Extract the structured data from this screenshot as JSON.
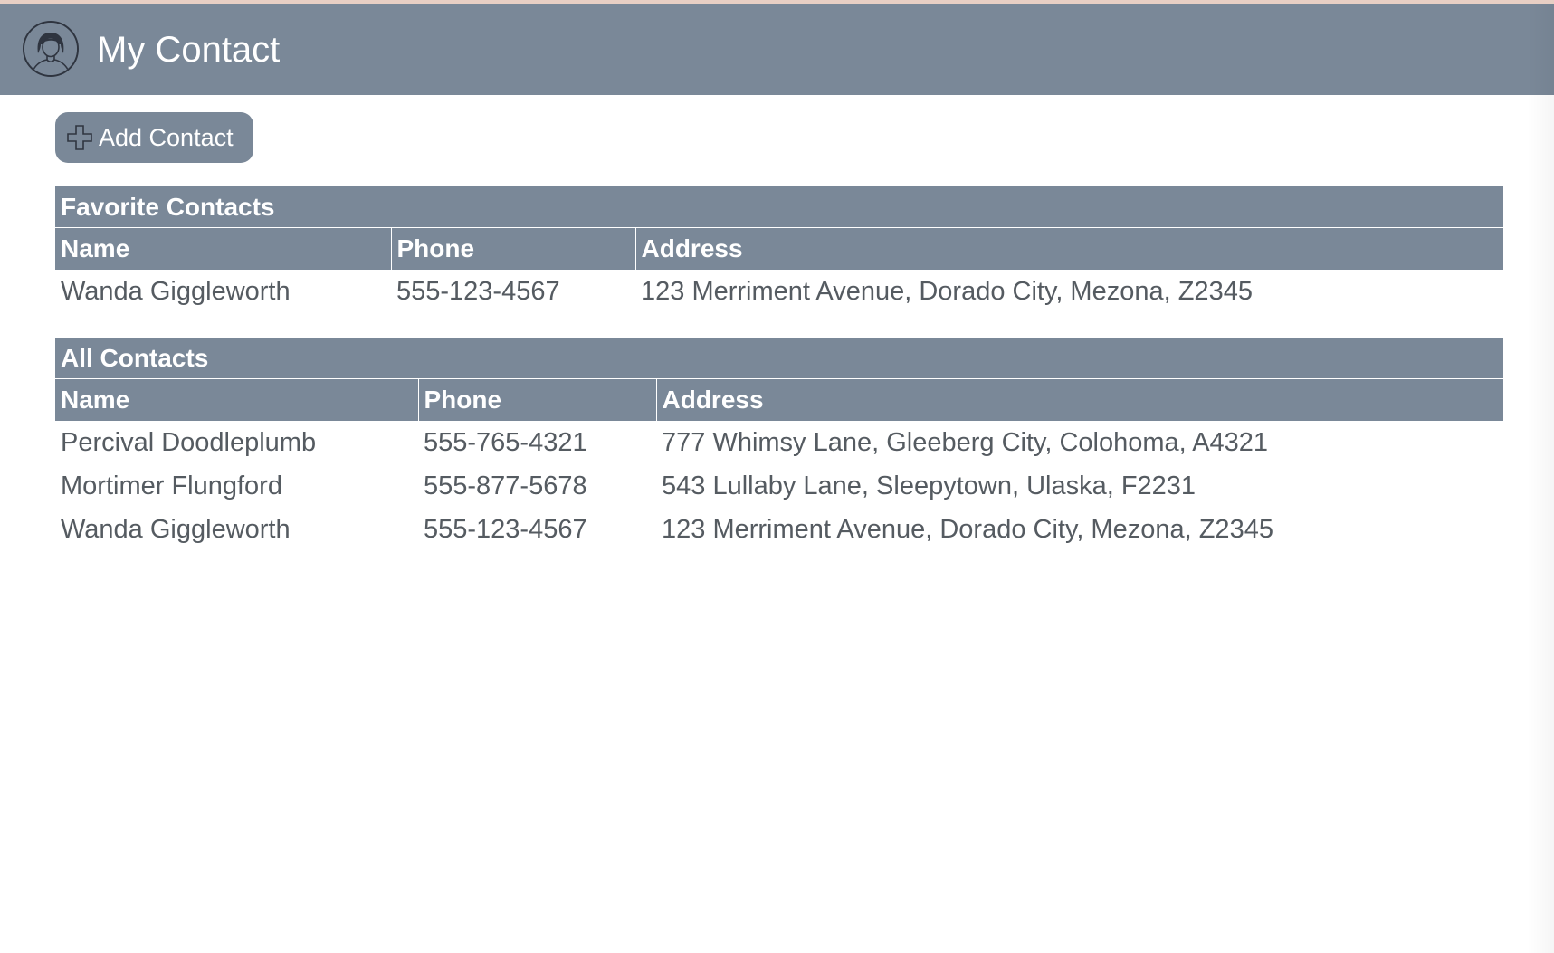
{
  "header": {
    "title": "My Contact",
    "avatar_icon": "user-avatar-icon"
  },
  "toolbar": {
    "add_label": "Add Contact",
    "add_icon": "plus-icon"
  },
  "colors": {
    "accent": "#7a8898",
    "header_text": "#ffffff",
    "cell_text": "#555b61",
    "top_strip": "#e8cfc4"
  },
  "favorites": {
    "title": "Favorite Contacts",
    "columns": [
      "Name",
      "Phone",
      "Address"
    ],
    "rows": [
      {
        "name": "Wanda Giggleworth",
        "phone": "555-123-4567",
        "address": "123 Merriment Avenue, Dorado City, Mezona, Z2345"
      }
    ]
  },
  "all_contacts": {
    "title": "All Contacts",
    "columns": [
      "Name",
      "Phone",
      "Address"
    ],
    "rows": [
      {
        "name": "Percival Doodleplumb",
        "phone": "555-765-4321",
        "address": "777 Whimsy Lane, Gleeberg City, Colohoma, A4321"
      },
      {
        "name": "Mortimer Flungford",
        "phone": "555-877-5678",
        "address": "543 Lullaby Lane, Sleepytown, Ulaska, F2231"
      },
      {
        "name": "Wanda Giggleworth",
        "phone": "555-123-4567",
        "address": "123 Merriment Avenue, Dorado City, Mezona, Z2345"
      }
    ]
  }
}
